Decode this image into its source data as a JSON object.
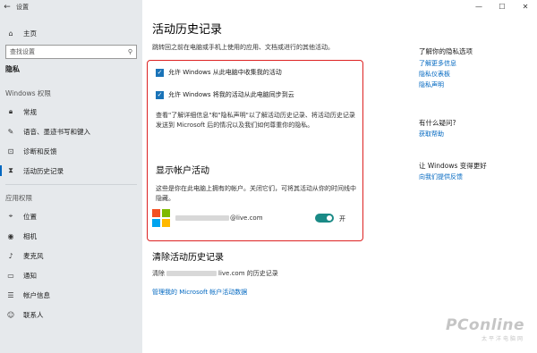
{
  "window": {
    "title": "设置",
    "controls": [
      "—",
      "☐",
      "✕"
    ]
  },
  "sidebar": {
    "home": "主页",
    "search_placeholder": "查找设置",
    "category": "隐私",
    "windows_section": "Windows 权限",
    "windows_items": [
      "常规",
      "语音、墨迹书写和键入",
      "诊断和反馈",
      "活动历史记录"
    ],
    "app_section": "应用权限",
    "app_items": [
      "位置",
      "相机",
      "麦克风",
      "通知",
      "帐户信息",
      "联系人"
    ]
  },
  "main": {
    "title": "活动历史记录",
    "description": "跳转回之前在电脑或手机上使用的应用、文档或进行的其他活动。",
    "check1": "允许 Windows 从此电脑中收集我的活动",
    "check2": "允许 Windows 将我的活动从此电脑同步到云",
    "paragraph": "查看\"了解详细信息\"和\"隐私声明\"以了解活动历史记录、将活动历史记录发送到 Microsoft 后的情况以及我们如何尊重你的隐私。",
    "show_accounts_head": "显示帐户活动",
    "show_accounts_desc": "这些是你在此电脑上拥有的帐户。关闭它们，可将其活动从你的时间线中隐藏。",
    "account_suffix": "@live.com",
    "toggle_label": "开",
    "clear_head": "清除活动历史记录",
    "clear_prefix": "清除",
    "clear_suffix": "live.com 的历史记录",
    "manage_link": "管理我的 Microsoft 帐户活动数据"
  },
  "right": {
    "privacy_head": "了解你的隐私选项",
    "privacy_links": [
      "了解更多信息",
      "隐私仪表板",
      "隐私声明"
    ],
    "question_head": "有什么疑问?",
    "help_link": "获取帮助",
    "improve_head": "让 Windows 变得更好",
    "feedback_link": "向我们提供反馈"
  },
  "watermark": {
    "main": "PConline",
    "sub": "太平洋电脑网"
  },
  "colors": {
    "accent": "#0067c0",
    "toggle_on": "#1a8a86",
    "checkbox": "#1a73b8",
    "highlight_box": "#dd2222",
    "ms_red": "#f25022",
    "ms_green": "#7fba00",
    "ms_blue": "#00a4ef",
    "ms_yellow": "#ffb900"
  }
}
